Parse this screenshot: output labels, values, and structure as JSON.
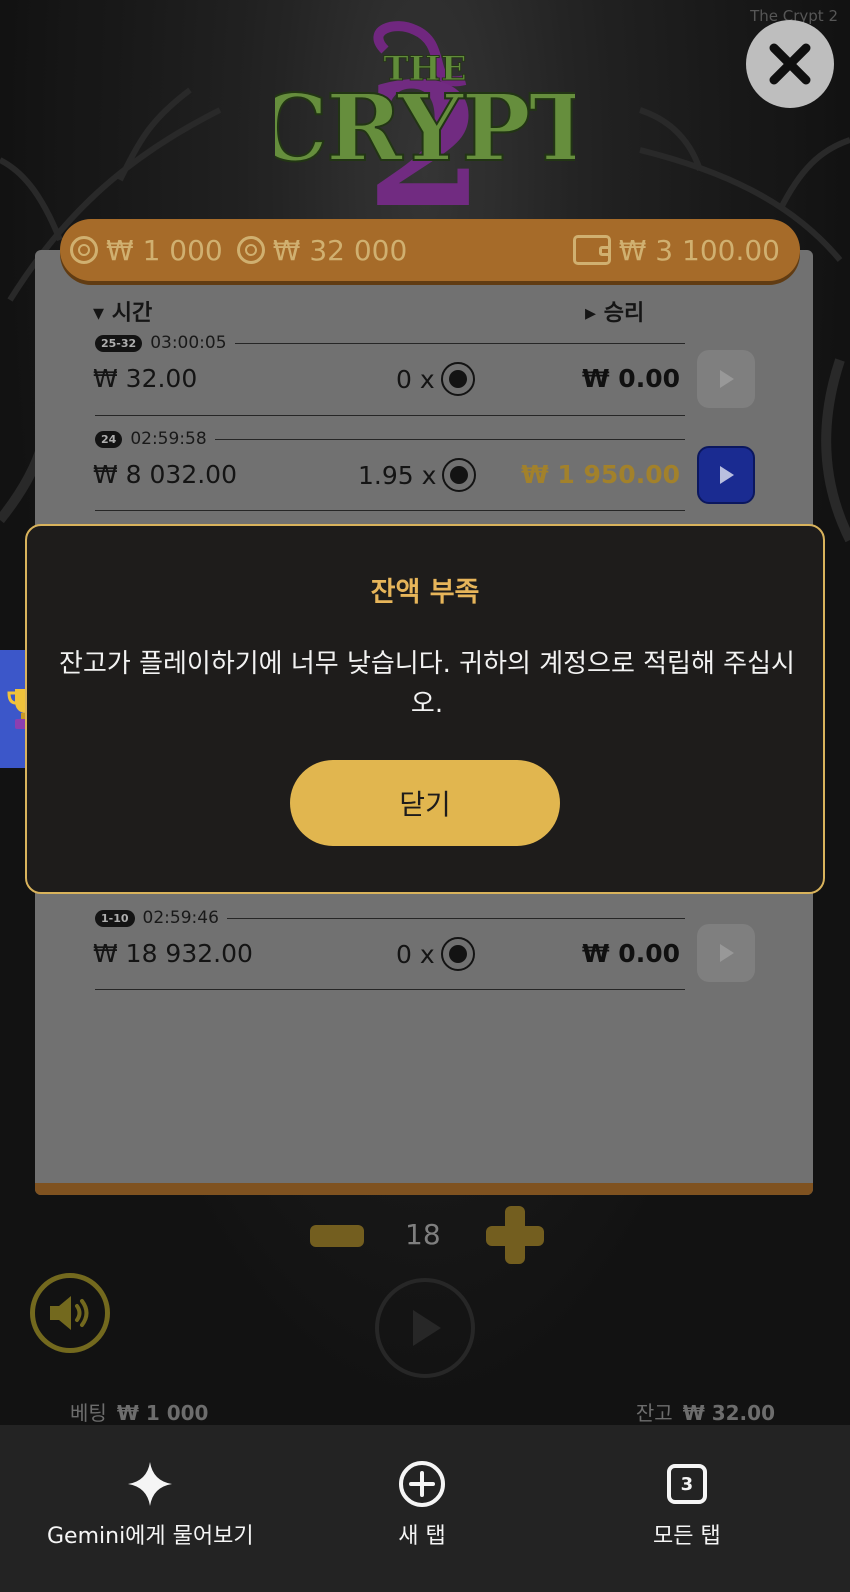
{
  "app": {
    "window_title": "The Crypt 2",
    "logo_text": "THE CRYPT 2"
  },
  "balance_bar": {
    "bet_coin": "₩ 1 000",
    "total_coin": "₩ 32 000",
    "wallet": "₩ 3 100.00"
  },
  "history": {
    "col_time": "시간",
    "col_win": "승리",
    "rows": [
      {
        "badge": "25-32",
        "time": "03:00:05",
        "bet": "₩ 32.00",
        "mult": "0 x",
        "win": "₩ 0.00",
        "win_highlight": false,
        "replay_active": false
      },
      {
        "badge": "24",
        "time": "02:59:58",
        "bet": "₩ 8 032.00",
        "mult": "1.95 x",
        "win": "₩ 1 950.00",
        "win_highlight": true,
        "replay_active": true
      },
      {
        "badge": "1-10",
        "time": "02:59:46",
        "bet": "₩ 18 932.00",
        "mult": "0 x",
        "win": "₩ 0.00",
        "win_highlight": false,
        "replay_active": false
      }
    ]
  },
  "stepper": {
    "value": "18"
  },
  "footer": {
    "bet_label": "베팅",
    "bet_value": "₩ 1 000",
    "balance_label": "잔고",
    "balance_value": "₩ 32.00"
  },
  "modal": {
    "title": "잔액 부족",
    "message": "잔고가 플레이하기에 너무 낮습니다. 귀하의 계정으로 적립해 주십시오.",
    "button": "닫기"
  },
  "browser": {
    "gemini_label": "Gemini에게 물어보기",
    "new_tab_label": "새 탭",
    "all_tabs_label": "모든 탭",
    "tab_count": "3"
  },
  "colors": {
    "accent_gold": "#e1b64f",
    "modal_bg": "#1e1c1b",
    "balance_bar": "#b5752d",
    "replay_blue": "#1d2f9e"
  }
}
